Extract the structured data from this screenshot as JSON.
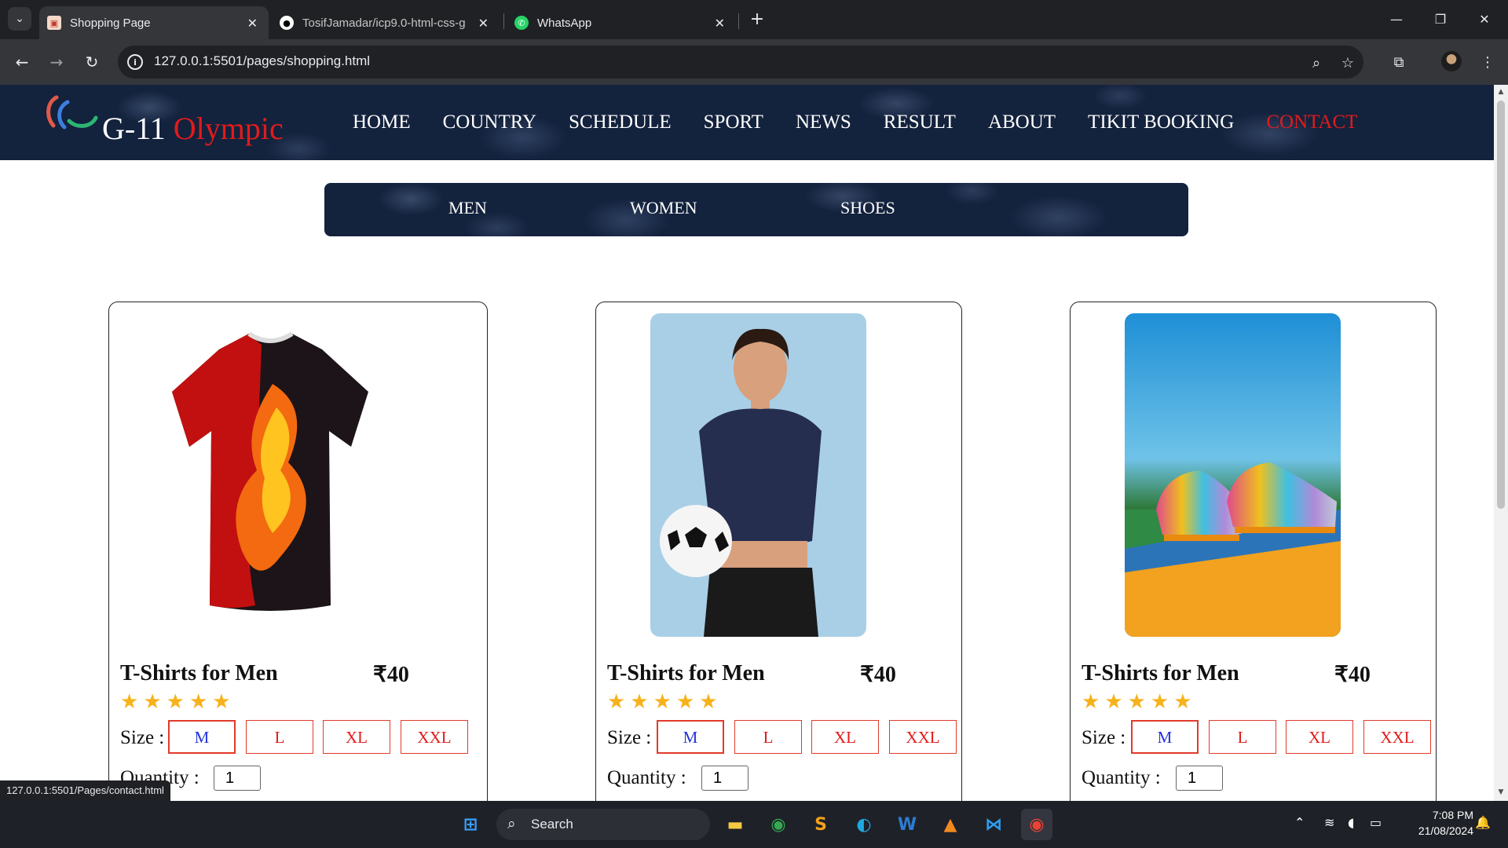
{
  "browser": {
    "tabs": [
      {
        "title": "Shopping Page",
        "active": true
      },
      {
        "title": "TosifJamadar/icp9.0-html-css-g",
        "active": false
      },
      {
        "title": "WhatsApp",
        "active": false
      }
    ],
    "url": "127.0.0.1:5501/pages/shopping.html",
    "status_url": "127.0.0.1:5501/Pages/contact.html"
  },
  "site": {
    "brand_first": "G-11",
    "brand_second": "Olympic",
    "nav": [
      "HOME",
      "COUNTRY",
      "SCHEDULE",
      "SPORT",
      "NEWS",
      "RESULT",
      "ABOUT",
      "TIKIT BOOKING",
      "CONTACT"
    ],
    "active_nav": "CONTACT",
    "subnav": [
      "MEN",
      "WOMEN",
      "SHOES"
    ]
  },
  "products": [
    {
      "title": "T-Shirts for Men",
      "price": "₹40",
      "rating": 5,
      "size_label": "Size :",
      "sizes": [
        "M",
        "L",
        "XL",
        "XXL"
      ],
      "selected_size": "M",
      "qty_label": "Quantity :",
      "qty": "1",
      "image": "fire-tshirt"
    },
    {
      "title": "T-Shirts for Men",
      "price": "₹40",
      "rating": 5,
      "size_label": "Size :",
      "sizes": [
        "M",
        "L",
        "XL",
        "XXL"
      ],
      "selected_size": "M",
      "qty_label": "Quantity :",
      "qty": "1",
      "image": "woman-football"
    },
    {
      "title": "T-Shirts for Men",
      "price": "₹40",
      "rating": 5,
      "size_label": "Size :",
      "sizes": [
        "M",
        "L",
        "XL",
        "XXL"
      ],
      "selected_size": "M",
      "qty_label": "Quantity :",
      "qty": "1",
      "image": "football-shoes"
    }
  ],
  "taskbar": {
    "search_label": "Search",
    "time": "7:08 PM",
    "date": "21/08/2024"
  },
  "colors": {
    "accent_red": "#e21b1b",
    "denim": "#13223d",
    "star": "#f7b21b"
  }
}
